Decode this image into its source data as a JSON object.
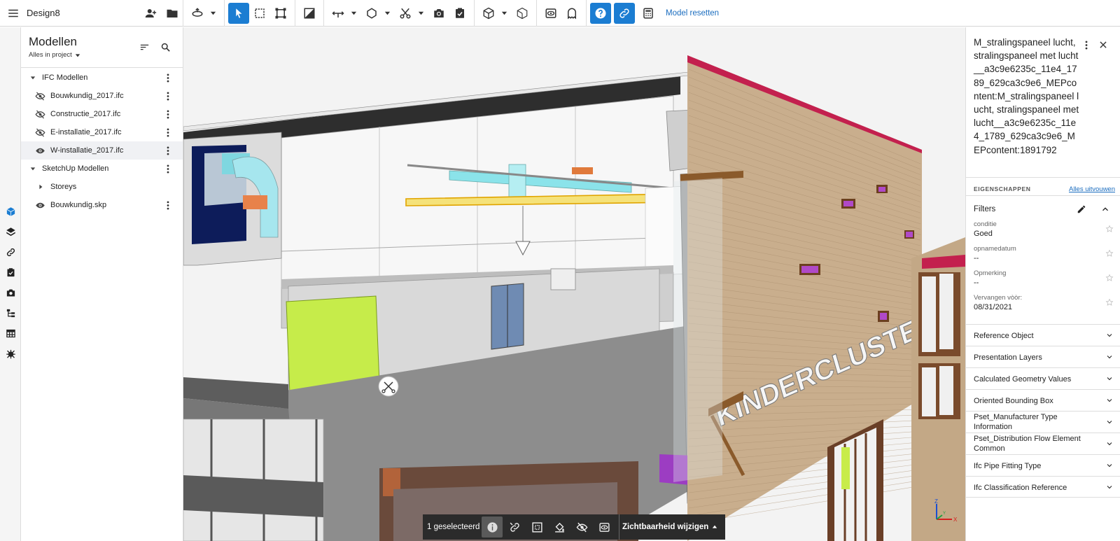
{
  "app": {
    "title": "Design8"
  },
  "toolbar": {
    "reset_label": "Model resetten",
    "icons": [
      "menu-icon",
      "add-user-icon",
      "folder-icon",
      "orbit-icon",
      "select-arrow-icon",
      "box-select-icon",
      "frame-icon",
      "plan-view-icon",
      "measure-icon",
      "shape-icon",
      "scissors-icon",
      "camera-icon",
      "checklist-icon",
      "cube-icon",
      "cube-outline-icon",
      "visibility-icon",
      "ghost-icon",
      "help-icon",
      "link-icon",
      "calculator-icon"
    ]
  },
  "models_panel": {
    "title": "Modellen",
    "filter": "Alles in project",
    "groups": [
      {
        "label": "IFC Modellen",
        "items": [
          {
            "label": "Bouwkundig_2017.ifc",
            "visible": false
          },
          {
            "label": "Constructie_2017.ifc",
            "visible": false
          },
          {
            "label": "E-installatie_2017.ifc",
            "visible": false
          },
          {
            "label": "W-installatie_2017.ifc",
            "visible": true
          }
        ]
      },
      {
        "label": "SketchUp Modellen",
        "items": [
          {
            "label": "Storeys",
            "collapsed": true
          },
          {
            "label": "Bouwkundig.skp",
            "visible": true
          }
        ]
      }
    ]
  },
  "rail": {
    "icons": [
      "model-cube-icon",
      "layers-icon",
      "link-icon",
      "checklist-icon",
      "camera-icon",
      "tree-icon",
      "table-icon",
      "bug-icon"
    ]
  },
  "viewport": {
    "sign_text": "KINDERCLUSTER"
  },
  "selection_toolbar": {
    "count_label": "1 geselecteerd",
    "visibility_label": "Zichtbaarheid wijzigen"
  },
  "axes": {
    "z": "Z",
    "x": "X",
    "y": "Y"
  },
  "properties": {
    "title": "M_stralingspaneel lucht, stralingspaneel met lucht__a3c9e6235c_11e4_1789_629ca3c9e6_MEPcontent:M_stralingspaneel lucht, stralingspaneel met lucht__a3c9e6235c_11e4_1789_629ca3c9e6_MEPcontent:1891792",
    "section_label": "EIGENSCHAPPEN",
    "expand_all": "Alles uitvouwen",
    "filters": {
      "title": "Filters",
      "rows": [
        {
          "key": "conditie",
          "value": "Goed"
        },
        {
          "key": "opnamedatum",
          "value": "--"
        },
        {
          "key": "Opmerking",
          "value": "--"
        },
        {
          "key": "Vervangen vòòr:",
          "value": "08/31/2021"
        }
      ]
    },
    "sections": [
      "Reference Object",
      "Presentation Layers",
      "Calculated Geometry Values",
      "Oriented Bounding Box",
      "Pset_Manufacturer Type Information",
      "Pset_Distribution Flow Element Common",
      "Ifc Pipe Fitting Type",
      "Ifc Classification Reference"
    ]
  }
}
